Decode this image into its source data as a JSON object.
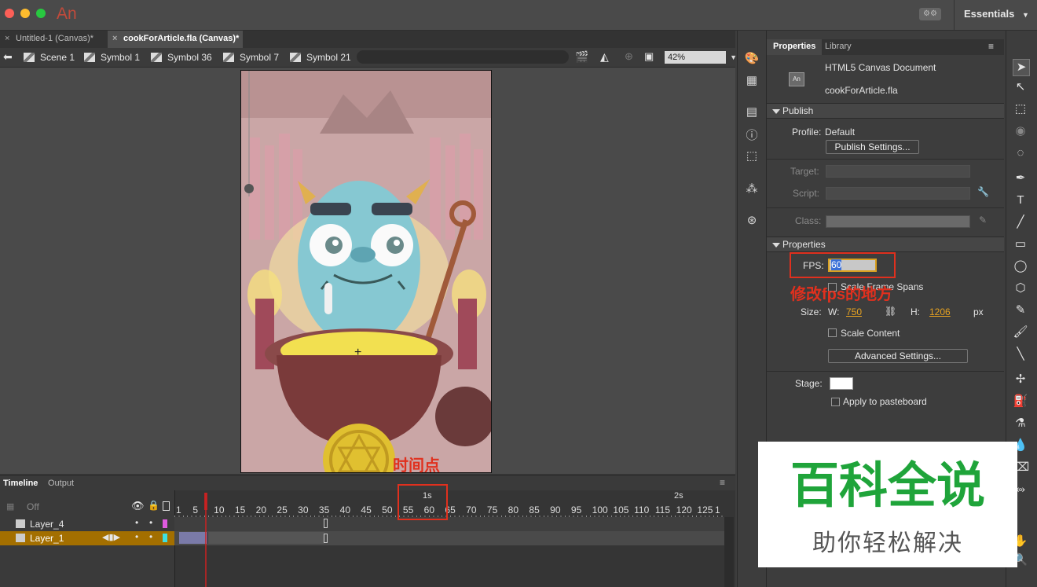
{
  "app": {
    "logo": "An",
    "workspace": "Essentials"
  },
  "document_tabs": [
    {
      "label": "Untitled-1 (Canvas)*",
      "active": false
    },
    {
      "label": "cookForArticle.fla (Canvas)*",
      "active": true
    }
  ],
  "breadcrumbs": [
    "Scene 1",
    "Symbol 1",
    "Symbol 36",
    "Symbol 7",
    "Symbol 21"
  ],
  "zoom": "42%",
  "annotations": {
    "time_point": "时间点",
    "fps_location": "修改fps的地方"
  },
  "timeline": {
    "tabs": [
      "Timeline",
      "Output"
    ],
    "onion_skin": "Off",
    "ruler_seconds": [
      "1s",
      "2s"
    ],
    "ruler_frames": [
      "1",
      "5",
      "10",
      "15",
      "20",
      "25",
      "30",
      "35",
      "40",
      "45",
      "50",
      "55",
      "60",
      "65",
      "70",
      "75",
      "80",
      "85",
      "90",
      "95",
      "100",
      "105",
      "110",
      "115",
      "120",
      "125",
      "1"
    ],
    "layers": [
      {
        "name": "Layer_4",
        "color": "#e05ae0",
        "selected": false
      },
      {
        "name": "Layer_1",
        "color": "#3ee0e0",
        "selected": true
      }
    ]
  },
  "properties": {
    "tabs": [
      "Properties",
      "Library"
    ],
    "doc_type": "HTML5 Canvas Document",
    "doc_icon": "An",
    "file_name": "cookForArticle.fla",
    "publish": {
      "section": "Publish",
      "profile_label": "Profile:",
      "profile_value": "Default",
      "publish_settings": "Publish Settings...",
      "target_label": "Target:",
      "script_label": "Script:",
      "class_label": "Class:"
    },
    "props": {
      "section": "Properties",
      "fps_label": "FPS:",
      "fps_value": "60",
      "scale_spans": "Scale Frame Spans",
      "size_label": "Size:",
      "w_label": "W:",
      "w_value": "750",
      "h_label": "H:",
      "h_value": "1206",
      "unit": "px",
      "scale_content": "Scale Content",
      "advanced_settings": "Advanced Settings...",
      "stage_label": "Stage:",
      "stage_color": "#ffffff",
      "apply_pasteboard": "Apply to pasteboard"
    }
  },
  "watermark": {
    "main": "百科全说",
    "sub": "助你轻松解决"
  }
}
